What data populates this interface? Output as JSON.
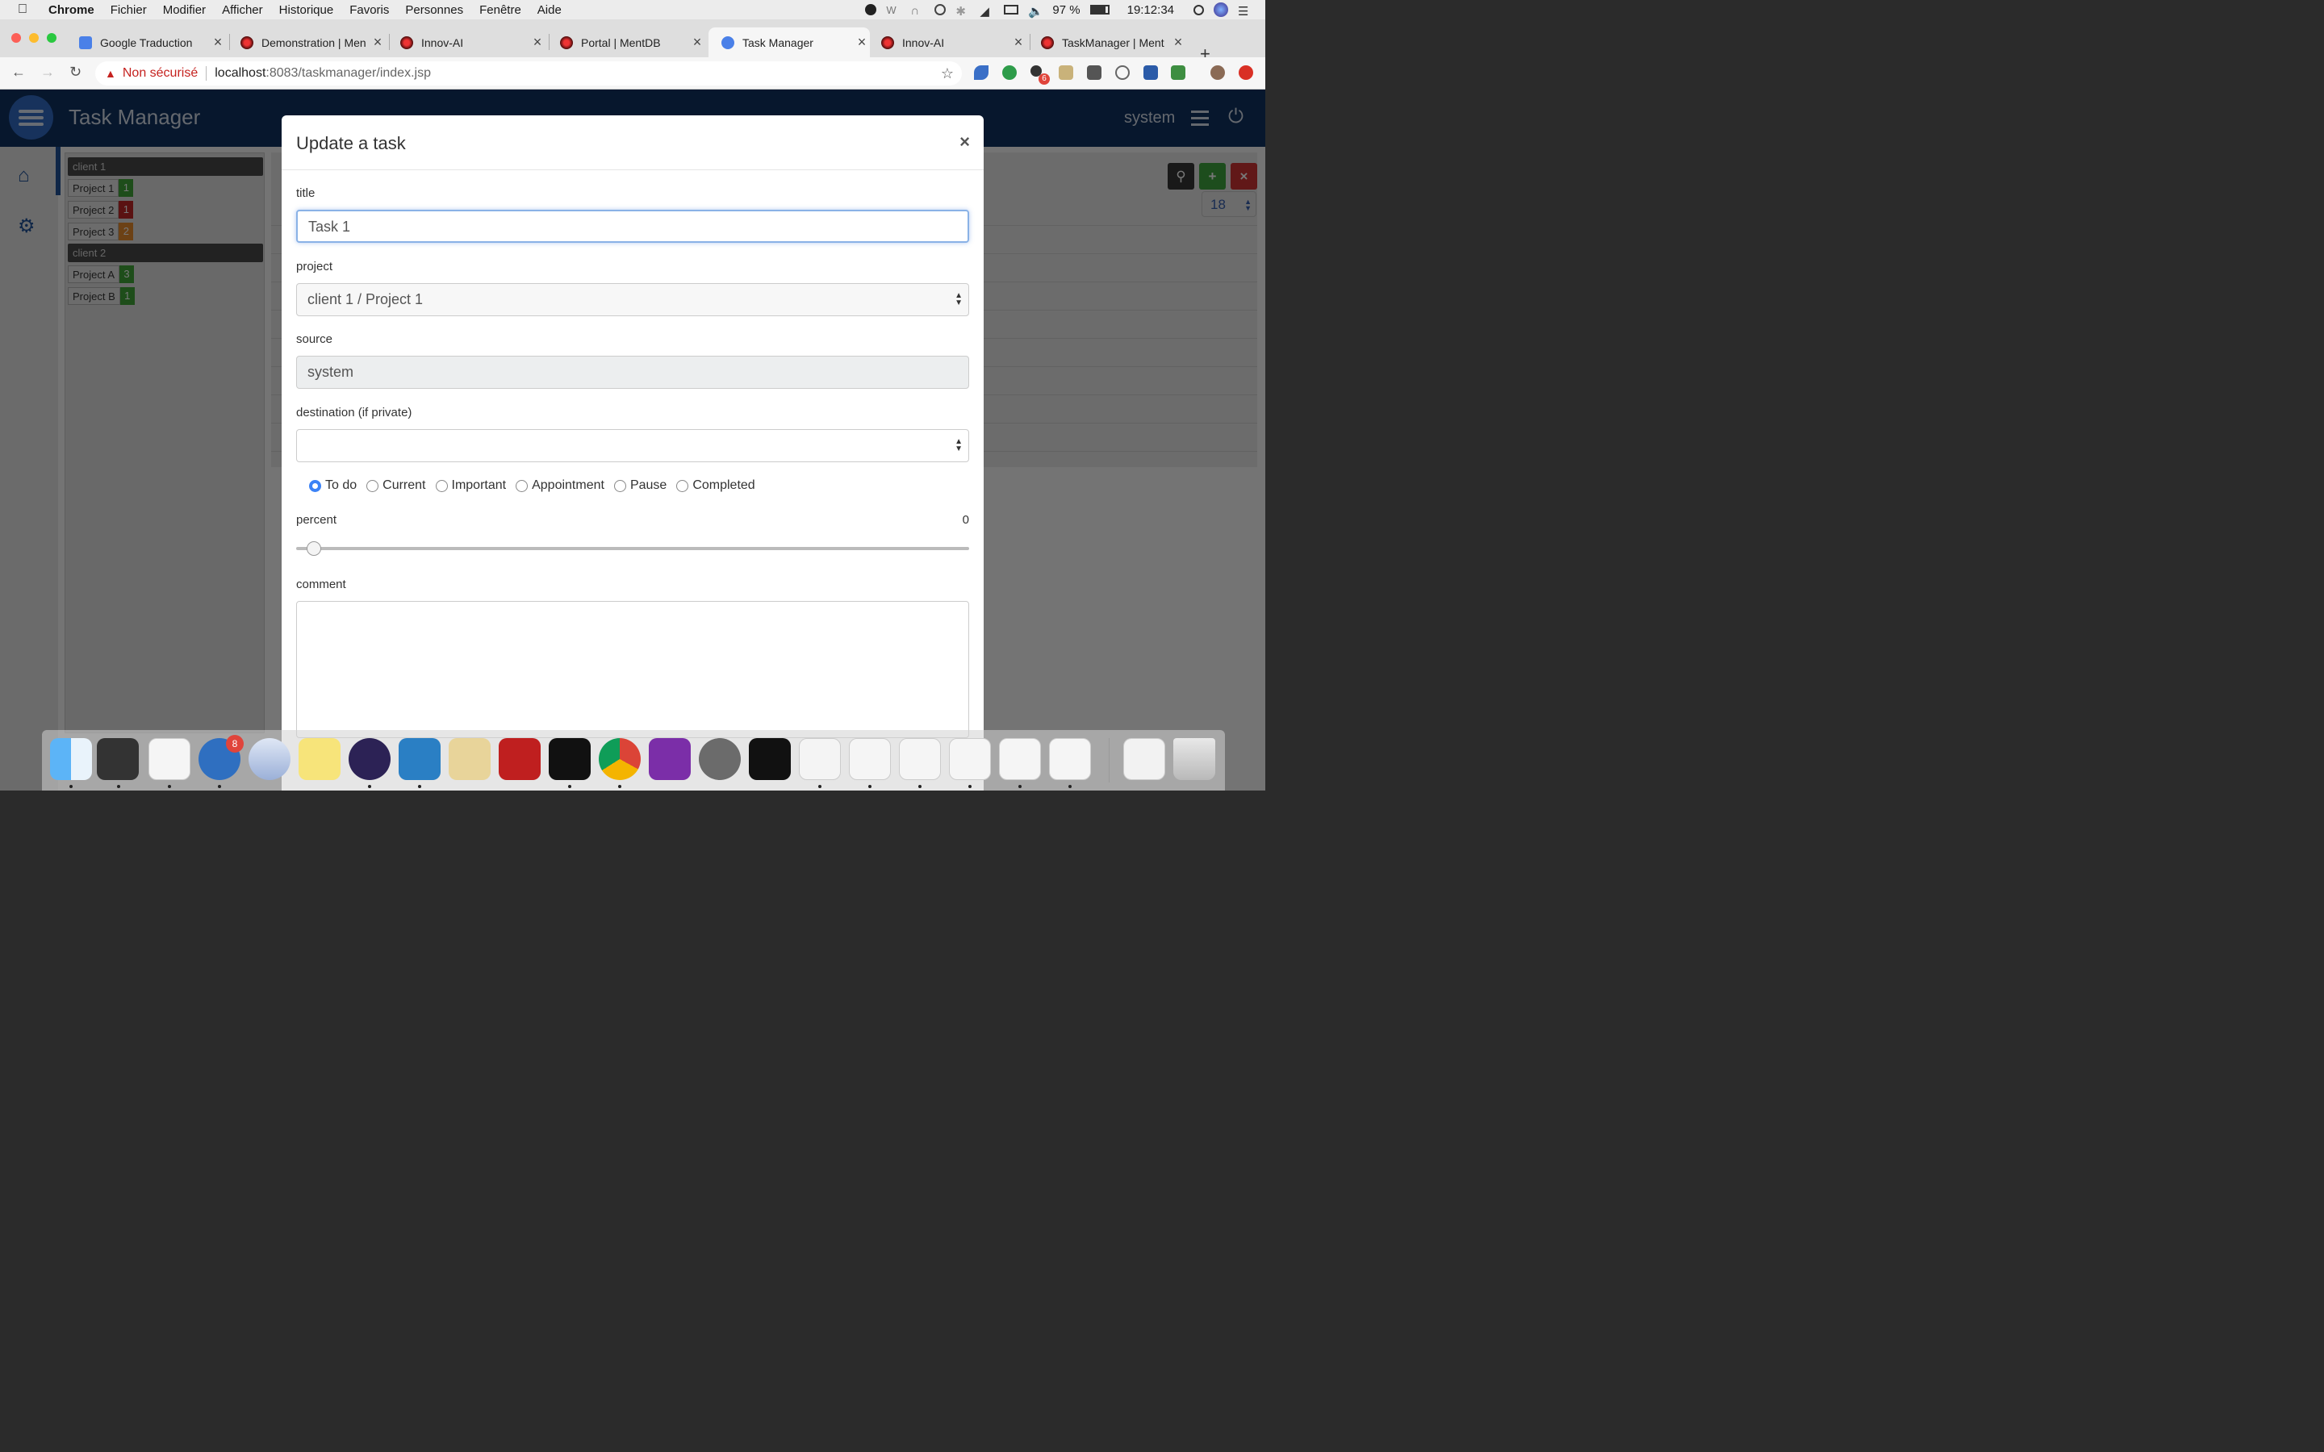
{
  "menubar": {
    "app": "Chrome",
    "items": [
      "Fichier",
      "Modifier",
      "Afficher",
      "Historique",
      "Favoris",
      "Personnes",
      "Fenêtre",
      "Aide"
    ],
    "battery": "97 %",
    "clock": "19:12:34"
  },
  "tabs": [
    {
      "label": "Google Traduction",
      "favicon_color": "#4a80e8"
    },
    {
      "label": "Demonstration | Men",
      "favicon_color": "#8b1a1a"
    },
    {
      "label": "Innov-AI",
      "favicon_color": "#8b1a1a"
    },
    {
      "label": "Portal | MentDB",
      "favicon_color": "#8b1a1a"
    },
    {
      "label": "Task Manager",
      "favicon_color": "#4a80e8"
    },
    {
      "label": "Innov-AI",
      "favicon_color": "#8b1a1a"
    },
    {
      "label": "TaskManager | Ment",
      "favicon_color": "#8b1a1a"
    }
  ],
  "addressbar": {
    "security": "Non sécurisé",
    "host": "localhost",
    "path": ":8083/taskmanager/index.jsp"
  },
  "extensions": {
    "badge_count": "6"
  },
  "app": {
    "title": "Task Manager",
    "user": "system",
    "header_color": "#0f2f5a",
    "accent_color": "#2f64b8"
  },
  "tree": {
    "clients": [
      {
        "name": "client 1",
        "projects": [
          {
            "name": "Project 1",
            "count": "1",
            "color": "#3d9b35"
          },
          {
            "name": "Project 2",
            "count": "1",
            "color": "#b52424"
          },
          {
            "name": "Project 3",
            "count": "2",
            "color": "#d9822b"
          }
        ]
      },
      {
        "name": "client 2",
        "projects": [
          {
            "name": "Project A",
            "count": "3",
            "color": "#3d9b35"
          },
          {
            "name": "Project B",
            "count": "1",
            "color": "#3d9b35"
          }
        ]
      }
    ]
  },
  "main": {
    "page_size": "18"
  },
  "modal": {
    "title": "Update a task",
    "close": "×",
    "title_label": "title",
    "title_value": "Task 1",
    "project_label": "project",
    "project_value": "client 1 / Project 1",
    "source_label": "source",
    "source_value": "system",
    "destination_label": "destination (if private)",
    "destination_value": "",
    "statuses": [
      {
        "label": "To do",
        "checked": true
      },
      {
        "label": "Current",
        "checked": false
      },
      {
        "label": "Important",
        "checked": false
      },
      {
        "label": "Appointment",
        "checked": false
      },
      {
        "label": "Pause",
        "checked": false
      },
      {
        "label": "Completed",
        "checked": false
      }
    ],
    "percent_label": "percent",
    "percent_value": "0",
    "comment_label": "comment",
    "comment_value": ""
  },
  "dock": {
    "mail_badge": "8",
    "apps": [
      "finder-icon",
      "process-icon",
      "java-icon",
      "mail-icon",
      "yoink-icon",
      "stickies-icon",
      "eclipse-icon",
      "bracket-icon",
      "taskpaper-icon",
      "filezilla-icon",
      "terminal-icon",
      "chrome-icon",
      "onenote-icon",
      "system-prefs-icon",
      "exec-icon",
      "textedit-icon",
      "java-icon",
      "java-icon",
      "java-icon",
      "java-icon",
      "java-icon",
      "archive-icon",
      "trash-icon"
    ]
  }
}
